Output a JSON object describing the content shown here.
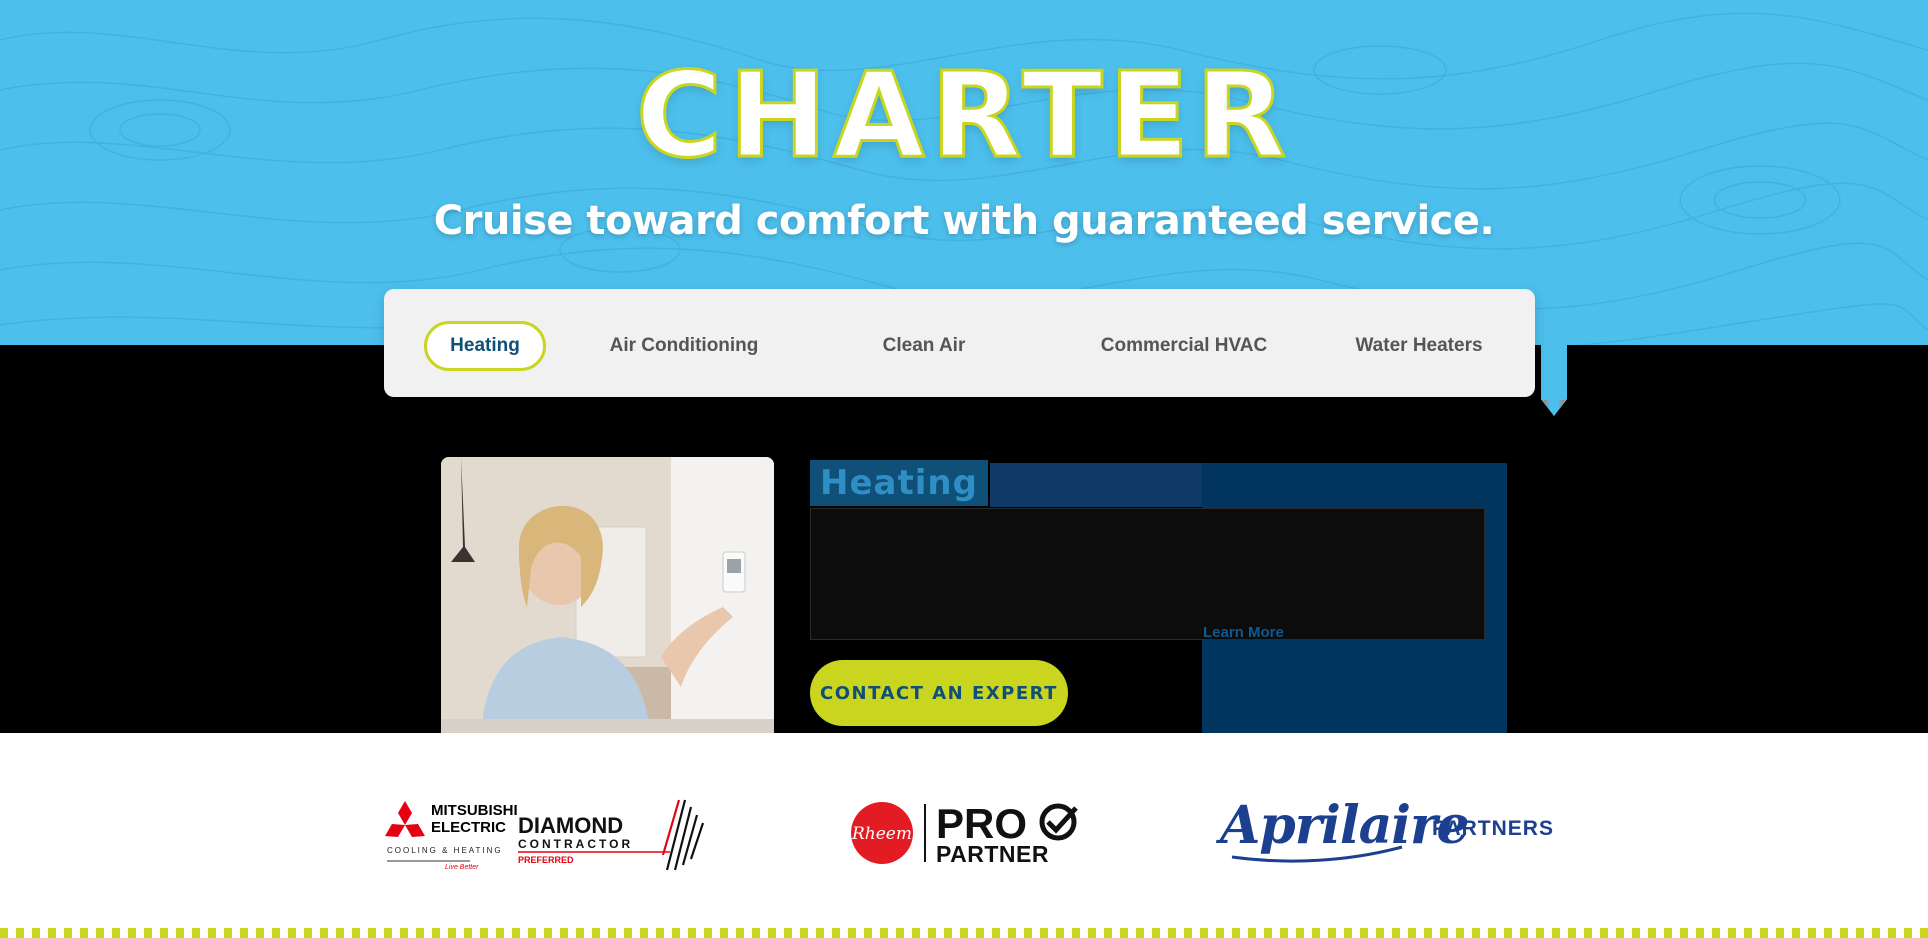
{
  "hero": {
    "brand": "CHARTER",
    "tagline": "Cruise toward comfort with guaranteed service."
  },
  "tabs": [
    {
      "label": "Heating",
      "active": true
    },
    {
      "label": "Air Conditioning",
      "active": false
    },
    {
      "label": "Clean Air",
      "active": false
    },
    {
      "label": "Commercial HVAC",
      "active": false
    },
    {
      "label": "Water Heaters",
      "active": false
    }
  ],
  "feature": {
    "title": "Heating",
    "learn_more": "Learn More",
    "cta": "CONTACT AN EXPERT"
  },
  "partners": {
    "mitsubishi": {
      "line1": "MITSUBISHI",
      "line2": "ELECTRIC",
      "sub": "COOLING & HEATING",
      "slogan": "Live Better",
      "diamond": "DIAMOND",
      "contractor": "CONTRACTOR",
      "preferred": "PREFERRED"
    },
    "rheem": {
      "badge": "Rheem",
      "pro": "PRO",
      "partner": "PARTNER"
    },
    "aprilaire": {
      "name": "Aprilaire",
      "label": "PARTNERS"
    }
  },
  "colors": {
    "sky": "#4cbfec",
    "lime": "#c9d51f",
    "navy": "#0f4f78",
    "rheem_red": "#e31b23",
    "aprilaire_blue": "#1c3f8f"
  }
}
